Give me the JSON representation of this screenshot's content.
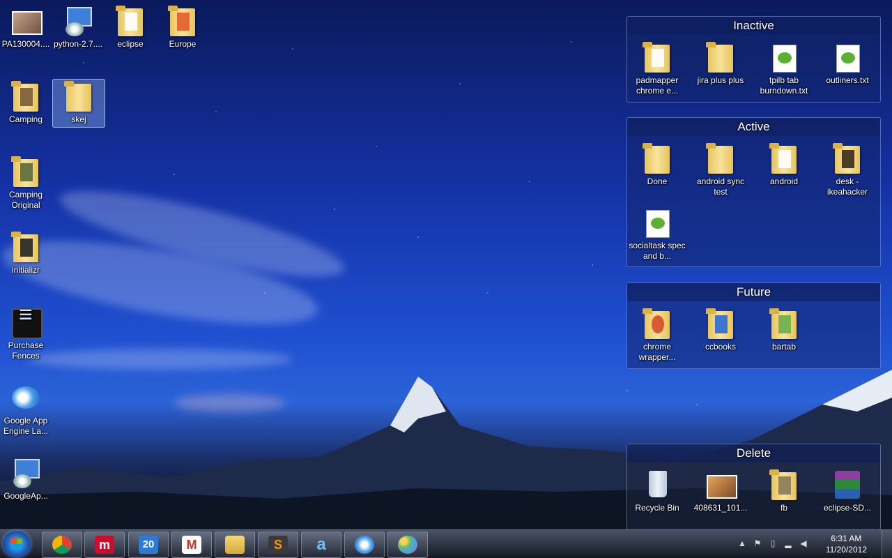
{
  "desktop_icons": [
    {
      "label": "PA130004....",
      "icon": "photo-icon"
    },
    {
      "label": "python-2.7....",
      "icon": "installer-icon"
    },
    {
      "label": "eclipse",
      "icon": "folder-icon"
    },
    {
      "label": "Europe",
      "icon": "folder-icon"
    },
    {
      "label": "Camping",
      "icon": "folder-icon"
    },
    {
      "label": "skej",
      "icon": "folder-icon"
    },
    {
      "label": "Camping Original",
      "icon": "folder-icon"
    },
    {
      "label": "initializr",
      "icon": "folder-icon"
    },
    {
      "label": "Purchase Fences",
      "icon": "fences-icon"
    },
    {
      "label": "Google App Engine La...",
      "icon": "app-engine-launcher-icon"
    },
    {
      "label": "GoogleAp...",
      "icon": "installer-icon"
    }
  ],
  "fences": {
    "inactive": {
      "title": "Inactive",
      "items": [
        "padmapper chrome e...",
        "jira plus plus",
        "tpilb tab burndown.txt",
        "outliners.txt"
      ]
    },
    "active": {
      "title": "Active",
      "items": [
        "Done",
        "android sync test",
        "android",
        "desk - ikeahacker",
        "socialtask spec and b..."
      ]
    },
    "future": {
      "title": "Future",
      "items": [
        "chrome wrapper...",
        "ccbooks",
        "bartab"
      ]
    },
    "delete": {
      "title": "Delete",
      "items": [
        "Recycle Bin",
        "408631_101...",
        "fb",
        "eclipse-SD..."
      ]
    }
  },
  "taskbar": {
    "apps": [
      "chrome-icon",
      "mendeley-icon",
      "calendar-icon",
      "gmail-icon",
      "explorer-icon",
      "sublime-icon",
      "aptana-icon",
      "app-engine-launcher-icon",
      "paint-icon"
    ],
    "calendar_day": "20",
    "clock_time": "6:31 AM",
    "clock_date": "11/20/2012",
    "tray_icons": [
      "show-hidden-icons",
      "action-center-icon",
      "battery-icon",
      "network-icon",
      "volume-icon"
    ]
  }
}
